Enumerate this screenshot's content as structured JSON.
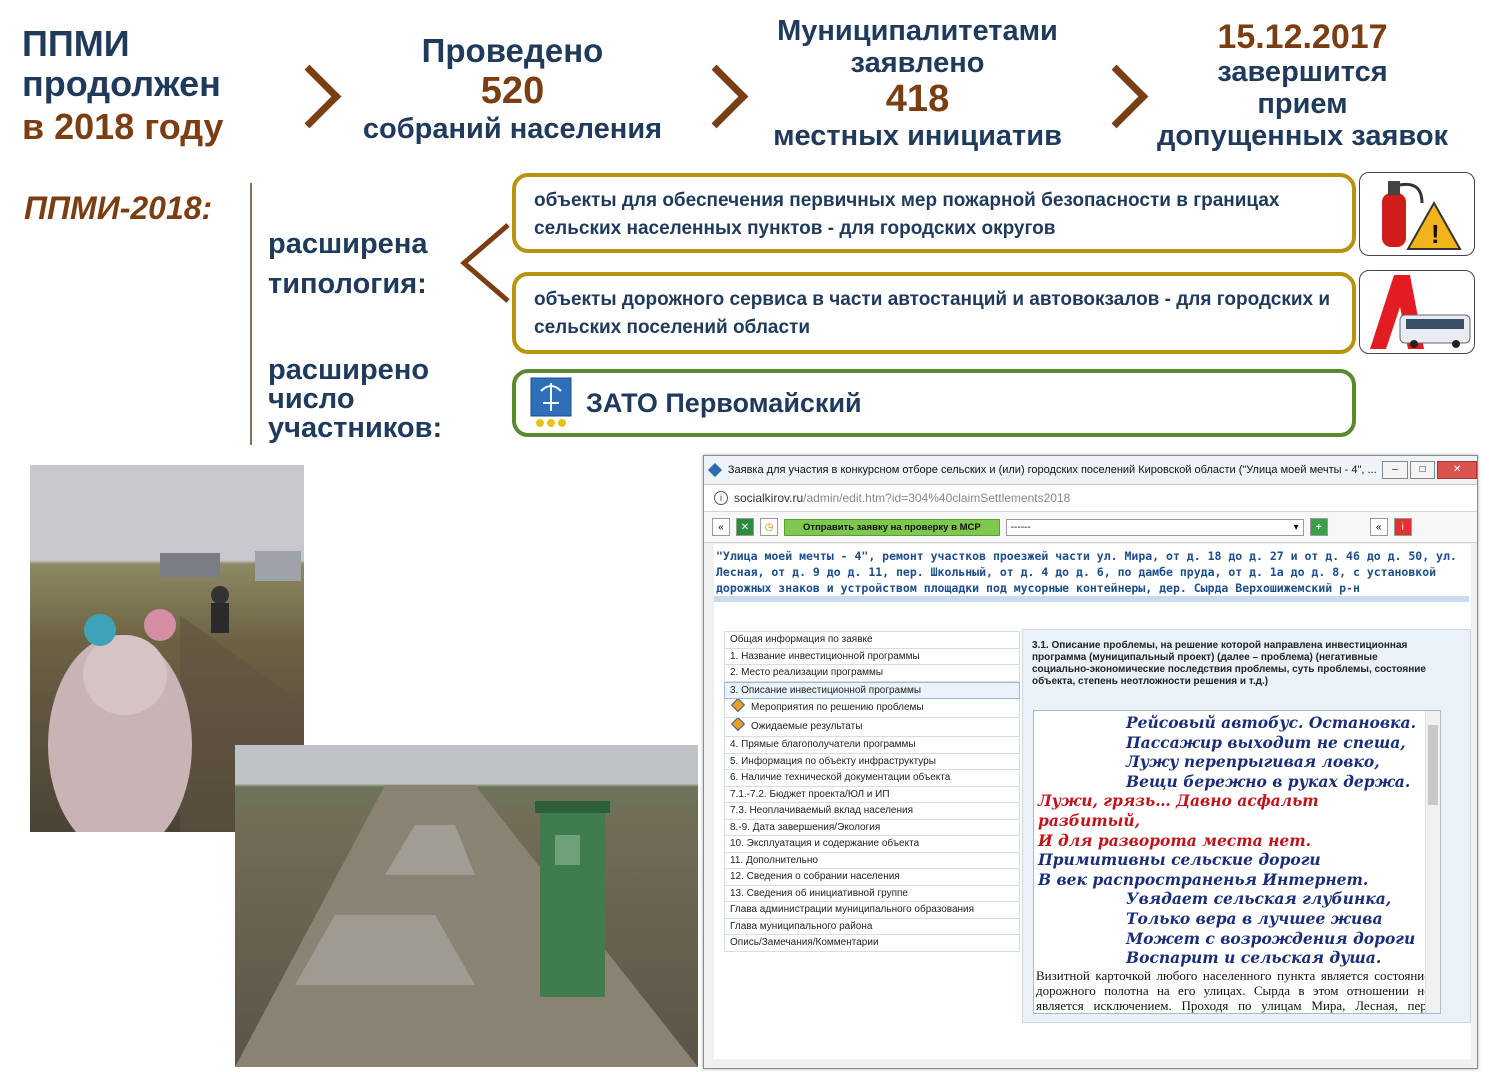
{
  "steps": {
    "s1": {
      "l1": "ППМИ",
      "l2": "продолжен",
      "l3": "в 2018 году"
    },
    "s2": {
      "l1": "Проведено",
      "num": "520",
      "l3": "собраний населения"
    },
    "s3": {
      "l1": "Муниципалитетами",
      "l2": "заявлено",
      "num": "418",
      "l4": "местных инициатив"
    },
    "s4": {
      "date": "15.12.2017",
      "l2": "завершится",
      "l3": "прием",
      "l4": "допущенных заявок"
    }
  },
  "ppmi2018": {
    "label": "ППМИ-2018:",
    "typology_label_1": "расширена",
    "typology_label_2": "типология:",
    "participants_label_1": "расширено",
    "participants_label_2": "число",
    "participants_label_3": "участников:",
    "card1": "объекты для обеспечения первичных мер пожарной безопасности в границах сельских населенных пунктов - для городских округов",
    "card2": "объекты дорожного сервиса в части автостанций и автовокзалов - для городских и сельских поселений области",
    "card3": "ЗАТО Первомайский"
  },
  "icons": [
    "fire-extinguisher-warning-icon",
    "bus-station-icon",
    "coat-of-arms-icon"
  ],
  "window": {
    "title": "Заявка для участия в конкурсном отборе сельских и (или) городских поселений Кировской области (\"Улица моей мечты - 4\", ...",
    "url_host": "socialkirov.ru",
    "url_path": "/admin/edit.htm?id=304%40claimSettlements2018",
    "send_button": "Отправить заявку на проверку в МСР",
    "select_value": "------",
    "heading": "\"Улица моей мечты - 4\", ремонт участков проезжей части ул. Мира, от д. 18 до д. 27 и от д. 46 до д. 50, ул. Лесная, от д. 9 до д. 11, пер. Школьный, от д. 4 до д. 6, по дамбе пруда, от д. 1а до д. 8, с установкой дорожных знаков и устройством площадки под мусорные контейнеры, дер. Сырда Верхошижемский р-н",
    "nav": [
      "Общая информация по заявке",
      "1. Название инвестиционной программы",
      "2. Место реализации программы",
      "3. Описание инвестиционной программы",
      "Мероприятия по решению проблемы",
      "Ожидаемые результаты",
      "4. Прямые благополучатели программы",
      "5. Информация по объекту инфраструктуры",
      "6. Наличие технической документации объекта",
      "7.1.-7.2. Бюджет проекта/ЮЛ и ИП",
      "7.3. Неоплачиваемый вклад населения",
      "8.-9. Дата завершения/Экология",
      "10. Эксплуатация и содержание объекта",
      "11. Дополнительно",
      "12. Сведения о собрании населения",
      "13. Сведения об инициативной группе",
      "Глава администрации муниципального образования",
      "Глава муниципального района",
      "Опись/Замечания/Комментарии"
    ],
    "section_title": "3.1. Описание проблемы, на решение которой направлена инвестиционная программа (муниципальный проект) (далее – проблема) (негативные социально-экономические последствия проблемы, суть проблемы, состояние объекта, степень неотложности решения и т.д.)",
    "poem": [
      "Рейсовый автобус. Остановка.",
      "Пассажир выходит не спеша,",
      "Лужу перепрыгивая ловко,",
      "Вещи бережно в руках держа.",
      "Лужи, грязь… Давно асфальт разбитый,",
      "И для разворота места нет.",
      "Примитивны сельские дороги",
      "В век распространенья Интернет.",
      "Увядает сельская глубинка,",
      "Только вера в лучшее жива",
      "Может с возрождения дороги",
      "Воспарит и сельская душа."
    ],
    "prose": "Визитной карточкой любого населенного пункта является состояние дорожного полотна на его улицах. Сырда в этом отношении не является исключением. Проходя по улицам Мира, Лесная, пер. Школьный и"
  },
  "colors": {
    "title_blue": "#1f3a5a",
    "accent_brown": "#7a3e12",
    "card_gold": "#b8930f",
    "card_green": "#5a8a2e"
  }
}
